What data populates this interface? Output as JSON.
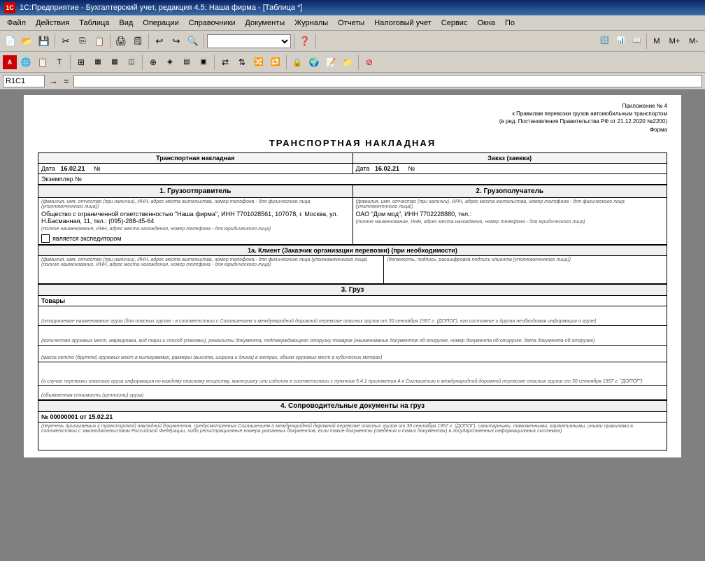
{
  "titleBar": {
    "icon": "1C",
    "text": "1С:Предприятие - Бухгалтерский учет, редакция 4.5: Наша фирма - [Таблица  *]"
  },
  "menuBar": {
    "items": [
      "Файл",
      "Действия",
      "Таблица",
      "Вид",
      "Операции",
      "Справочники",
      "Документы",
      "Журналы",
      "Отчеты",
      "Налоговый учет",
      "Сервис",
      "Окна",
      "По"
    ]
  },
  "toolbar1": {
    "buttons": [
      "📁",
      "💾",
      "🖨",
      "✂",
      "📋",
      "📄",
      "🖨",
      "📊",
      "↩",
      "↪",
      "🔍"
    ],
    "combo": "",
    "mButtons": [
      "M",
      "M+",
      "M-"
    ]
  },
  "formulaBar": {
    "cellRef": "R1C1",
    "value": ""
  },
  "document": {
    "appNote": {
      "line1": "Приложение № 4",
      "line2": "к Правилам перевозки грузов автомобильным транспортом",
      "line3": "(в ред. Постановления Правительства РФ от 21.12.2020 №2200)",
      "line4": "Форма"
    },
    "title": "ТРАНСПОРТНАЯ НАКЛАДНАЯ",
    "section1Header": "Транспортная накладная",
    "section1Right": "Заказ (заявка)",
    "dateLabel": "Дата",
    "dateValue1": "16.02.21",
    "numberLabel": "№",
    "dateValue2": "16.02.21",
    "numberLabel2": "№",
    "exampleLabel": "Экземпляр №",
    "sec1Header": "1. Грузоотправитель",
    "sec2Header": "2. Грузополучатель",
    "sec1SmallLabel": "(фамилия, имя, отчество (при наличии), ИНН, адрес места жительства, номер телефона - для физического лица (уполномоченного лица))",
    "sec1FullLabel": "(полное наименование, ИНН, адрес места нахождения, номер телефона - для юридического лица)",
    "sec1Value": "Общество с ограниченной ответственностью \"Наша фирма\", ИНН 7701028561, 107078, г. Москва, ул. Н.Басманная, 11, тел.: (095)-288-45-64",
    "sec2SmallLabel": "(фамилия, имя, отчество (при наличии), ИНН, адрес места жительства, номер телефона - для физического лица (уполномоченного лица))",
    "sec2FullLabel": "(полное наименование, ИНН, адрес места нахождения, номер телефона - для юридического лица)",
    "sec2Value": "ОАО \"Дом мод\", ИНН 7702228880, тел.:",
    "isExpeditor": "является экспедитором",
    "sec1aHeader": "1а. Клиент (Заказчик организации перевозки) (при необходимости)",
    "sec1aSmallLabel": "(фамилия, имя, отчество (при наличии), ИНН, адрес места жительства, номер телефона - для физического лица (уполномоченного лица) (полное наименование, ИНН, адрес места нахождения, номер телефона - для юридического лица)",
    "sec1aRightLabel": "(должность, подпись, расшифровка подписи клиента (уполномоченного лица))",
    "sec3Header": "3. Груз",
    "sec3GoodsLabel": "Товары",
    "sec3SmallLabel1": "(отгружаемое наименование груза (для опасных грузов - в соответствии с Соглашением о международной дорожной перевозке опасных грузов от 30 сентября 1957 г. (ДОПОГ), его состояние и другая необходимая информация о грузе)",
    "sec3SmallLabel2": "(количество грузовых мест, маркировка, вид тары и способ упаковки), реквизиты документа, подтверждающего отгрузку товаров (наименование документов об отгрузке, номер документа об отгрузке, дата документа об отгрузке)",
    "sec3SmallLabel3": "(масса нетто (брутто) грузовых мест в килограммах, размеры (высота, ширина и длина) в метрах, объем грузовых мест в кубических метрах)",
    "sec3SmallLabel4": "(а случае перевозки опасного груза информация по каждому опасному веществу, материалу или изделию в соответствии с пунктом 5.4.1 приложения А к Соглашению о международной дорожной перевозке опасных грузов от 30 сентября 1957 г. \"ДОПОГ\")",
    "sec3SmallLabel5": "(объявленная стоимость (ценность) груза)",
    "sec4Header": "4. Сопроводительные документы на груз",
    "sec4DocNumber": "№ 00000001 от 15.02.21",
    "sec4SmallLabel": "(перечень прилагаемых к транспортной накладной документов, предусмотренных Соглашением о международной дорожной перевозке опасных грузов от 30 сентября 1957 г. (ДОПОГ), санитарными, таможенными, карантинными, иными правилами в соответствии с законодательством Российской Федерации, либо регистрационные номера указанных документов, если такие документы (сведения о таких документах) в государственных информационных системах)"
  }
}
